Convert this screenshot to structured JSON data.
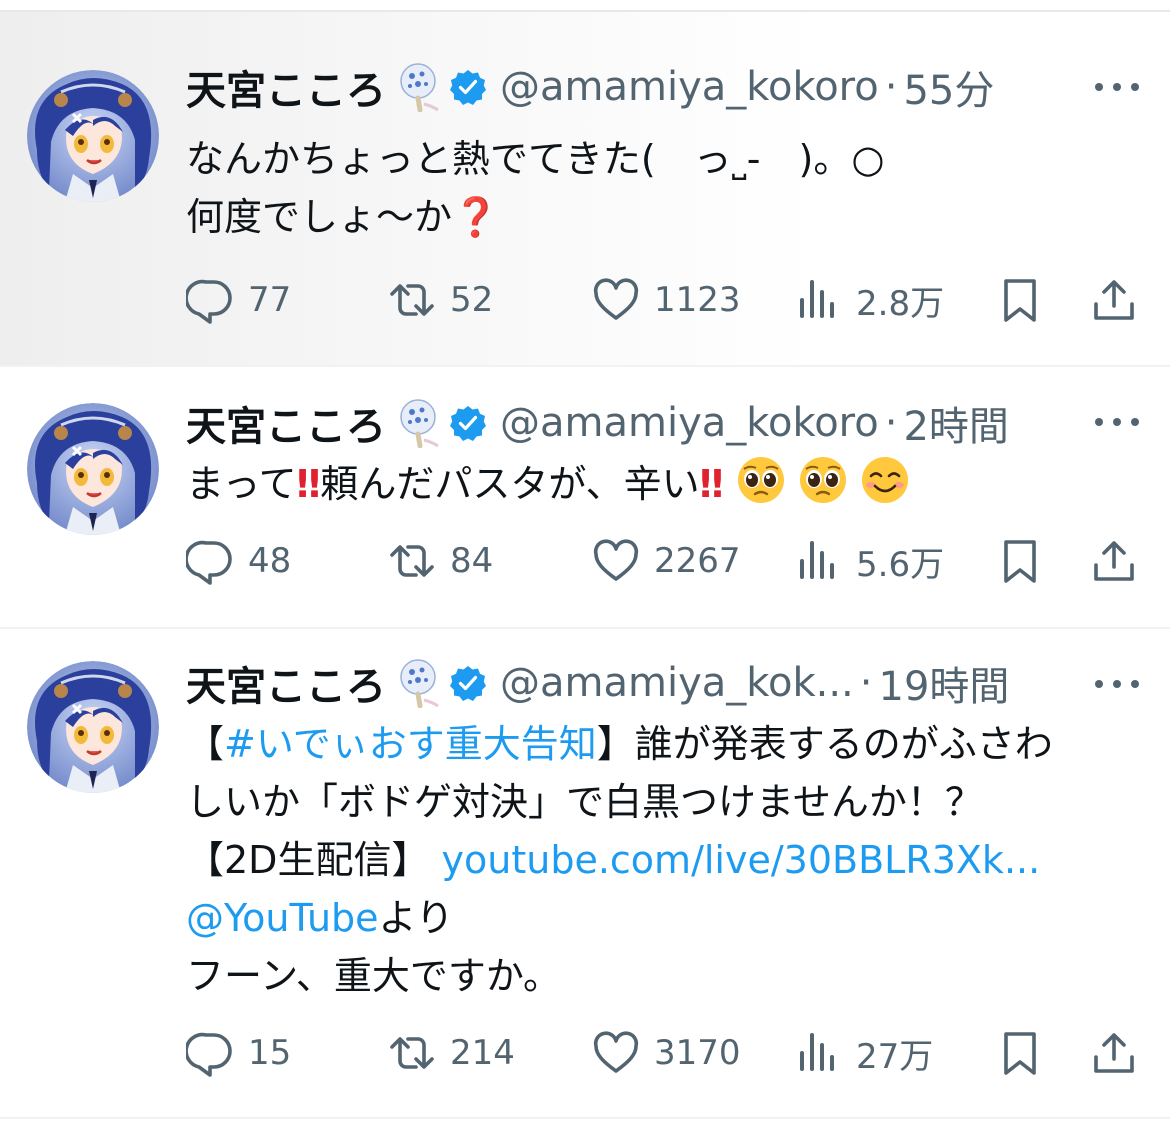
{
  "tweets": [
    {
      "name": "天宮こころ",
      "handle": "@amamiya_kokoro",
      "separator": "·",
      "time": "55分",
      "line1": "なんかちょっと熱でてきた(　っ˽-　)。○",
      "line2_text": "何度でしょ〜か",
      "line2_emoji": "❓",
      "stats": {
        "replies": "77",
        "reposts": "52",
        "likes": "1123",
        "views": "2.8万"
      }
    },
    {
      "name": "天宮こころ",
      "handle": "@amamiya_kokoro",
      "separator": "·",
      "time": "2時間",
      "part1": "まって",
      "bang1": "‼",
      "part2": "頼んだパスタが、辛い",
      "bang2": "‼",
      "stats": {
        "replies": "48",
        "reposts": "84",
        "likes": "2267",
        "views": "5.6万"
      }
    },
    {
      "name": "天宮こころ",
      "handle": "@amamiya_kok...",
      "separator": "·",
      "time": "19時間",
      "bracket_open": "【",
      "hashtag": "#いでぃおす重大告知",
      "after_hashtag": "】誰が発表するのがふさわ",
      "line2": "しいか「ボドゲ対決」で白黒つけませんか！？",
      "line3_prefix": "【2D生配信】 ",
      "link": "youtube.com/live/30BBLR3Xk...",
      "mention": "@YouTube",
      "mention_suffix": "より",
      "line5": "フーン、重大ですか。",
      "stats": {
        "replies": "15",
        "reposts": "214",
        "likes": "3170",
        "views": "27万"
      }
    }
  ],
  "icons": [
    "avatar",
    "uchiwa-fan-icon",
    "verified-badge-icon",
    "more-icon",
    "reply-icon",
    "repost-icon",
    "like-icon",
    "views-icon",
    "bookmark-icon",
    "share-icon",
    "pleading-face-emoji",
    "smiling-face-emoji"
  ],
  "colors": {
    "text": "#0f1419",
    "muted": "#536471",
    "link": "#1d9bf0",
    "verified": "#1d9bf0",
    "bang": "#e0212f"
  }
}
